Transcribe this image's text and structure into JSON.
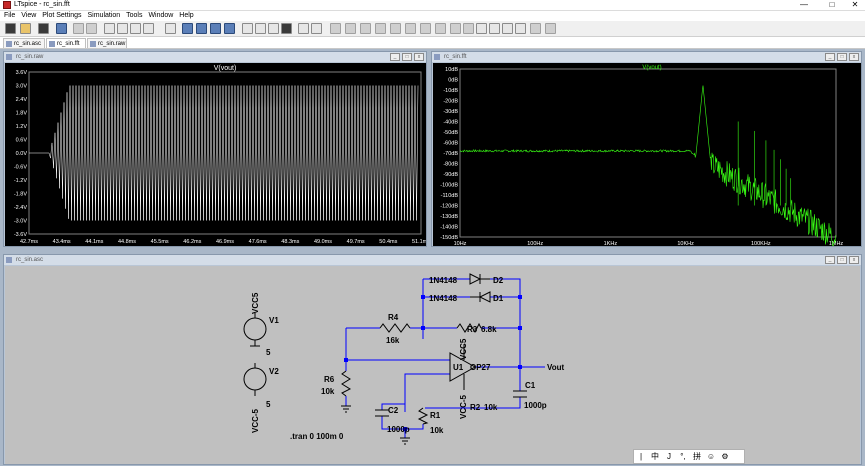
{
  "window": {
    "title": "LTspice - rc_sin.fft",
    "min": "—",
    "max": "□",
    "close": "✕"
  },
  "menu": [
    "File",
    "View",
    "Plot Settings",
    "Simulation",
    "Tools",
    "Window",
    "Help"
  ],
  "tabs": [
    "rc_sin.asc",
    "rc_sin.fft",
    "rc_sin.raw"
  ],
  "waveform_window": {
    "caption": "rc_sin.raw",
    "trace_title": "V(vout)",
    "y_ticks": [
      "3.6V",
      "3.0V",
      "2.4V",
      "1.8V",
      "1.2V",
      "0.6V",
      "0.0V",
      "-0.6V",
      "-1.2V",
      "-1.8V",
      "-2.4V",
      "-3.0V",
      "-3.6V"
    ],
    "x_ticks": [
      "42.7ms",
      "43.4ms",
      "44.1ms",
      "44.8ms",
      "45.5ms",
      "46.2ms",
      "46.9ms",
      "47.6ms",
      "48.3ms",
      "49.0ms",
      "49.7ms",
      "50.4ms",
      "51.1ms"
    ]
  },
  "fft_window": {
    "caption": "rc_sin.fft",
    "trace_title": "V(vout)",
    "y_ticks": [
      "10dB",
      "0dB",
      "-10dB",
      "-20dB",
      "-30dB",
      "-40dB",
      "-50dB",
      "-60dB",
      "-70dB",
      "-80dB",
      "-90dB",
      "-100dB",
      "-110dB",
      "-120dB",
      "-130dB",
      "-140dB",
      "-150dB"
    ],
    "x_ticks": [
      "10Hz",
      "100Hz",
      "1KHz",
      "10KHz",
      "100KHz",
      "1MHz"
    ]
  },
  "schematic_window": {
    "caption": "rc_sin.asc",
    "labels": {
      "vcc5_top": "VCC5",
      "v1": "V1",
      "v1_val": "5",
      "v2": "V2",
      "v2_val": "5",
      "vcc_neg": "VCC-5",
      "d2_model": "1N4148",
      "d2": "D2",
      "d1_model": "1N4148",
      "d1": "D1",
      "r4": "R4",
      "r4_val": "16k",
      "r3": "R3",
      "r3_val": "6.8k",
      "op_vcc5": "VCC5",
      "u1": "U1",
      "op27": "OP27",
      "op_vccneg": "VCC-5",
      "r6": "R6",
      "r6_val": "10k",
      "vout": "Vout",
      "c1": "C1",
      "c1_val": "1000p",
      "r2": "R2",
      "r2_val": "10k",
      "c2": "C2",
      "c2_val": "1000p",
      "r1": "R1",
      "r1_val": "10k",
      "directive": ".tran 0 100m 0"
    }
  },
  "ime_bar": {
    "items": [
      "|",
      "中",
      "J",
      "°,",
      "拼",
      "☺",
      "⚙"
    ]
  },
  "colors": {
    "trace_wave": "#ffffff",
    "trace_fft": "#39ff14",
    "wire": "#0000ff",
    "plot_bg": "#000000",
    "schematic_bg": "#c0c0c0"
  }
}
